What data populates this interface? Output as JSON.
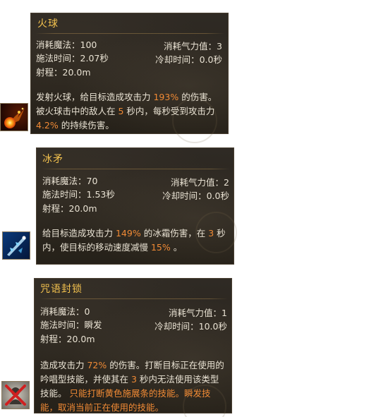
{
  "skills": [
    {
      "name": "火球",
      "icon": "fireball-icon",
      "mana_label": "消耗魔法：",
      "mana_value": "100",
      "qi_label": "消耗气力值：",
      "qi_value": "3",
      "cast_label": "施法时间：",
      "cast_value": "2.07秒",
      "cooldown_label": "冷却时间：",
      "cooldown_value": "0.0秒",
      "range_label": "射程：",
      "range_value": "20.0m",
      "desc": [
        {
          "t": "发射火球，给目标造成攻击力 "
        },
        {
          "t": "193%",
          "hl": true
        },
        {
          "t": " 的伤害。被火球击中的敌人在 "
        },
        {
          "t": "5",
          "hl": true
        },
        {
          "t": " 秒内，每秒受到攻击力 "
        },
        {
          "t": "4.2%",
          "hl": true
        },
        {
          "t": " 的持续伤害。"
        }
      ]
    },
    {
      "name": "冰矛",
      "icon": "ice-spear-icon",
      "mana_label": "消耗魔法：",
      "mana_value": "70",
      "qi_label": "消耗气力值：",
      "qi_value": "2",
      "cast_label": "施法时间：",
      "cast_value": "1.53秒",
      "cooldown_label": "冷却时间：",
      "cooldown_value": "0.0秒",
      "range_label": "射程：",
      "range_value": "20.0m",
      "desc": [
        {
          "t": "给目标造成攻击力 "
        },
        {
          "t": "149%",
          "hl": true
        },
        {
          "t": " 的冰霜伤害，在 "
        },
        {
          "t": "3",
          "hl": true
        },
        {
          "t": " 秒内，使目标的移动速度减慢 "
        },
        {
          "t": "15%",
          "hl": true
        },
        {
          "t": " 。"
        }
      ]
    },
    {
      "name": "咒语封锁",
      "icon": "spell-lock-icon",
      "mana_label": "消耗魔法：",
      "mana_value": "0",
      "qi_label": "消耗气力值：",
      "qi_value": "1",
      "cast_label": "施法时间：",
      "cast_value": "瞬发",
      "cooldown_label": "冷却时间：",
      "cooldown_value": "10.0秒",
      "range_label": "射程：",
      "range_value": "20.0m",
      "desc": [
        {
          "t": "造成攻击力 "
        },
        {
          "t": "72%",
          "hl": true
        },
        {
          "t": " 的伤害。打断目标正在使用的吟唱型技能，并使其在 "
        },
        {
          "t": "3",
          "hl": true
        },
        {
          "t": " 秒内无法使用该类型技能。 "
        },
        {
          "t": "只能打断黄色施展条的技能。瞬发技能，取消当前正在使用的技能。",
          "hl": true
        }
      ]
    }
  ],
  "colors": {
    "title": "#f2c14e",
    "highlight": "#f08a35",
    "text": "#e9e2d3",
    "panel": "#2a2520"
  }
}
